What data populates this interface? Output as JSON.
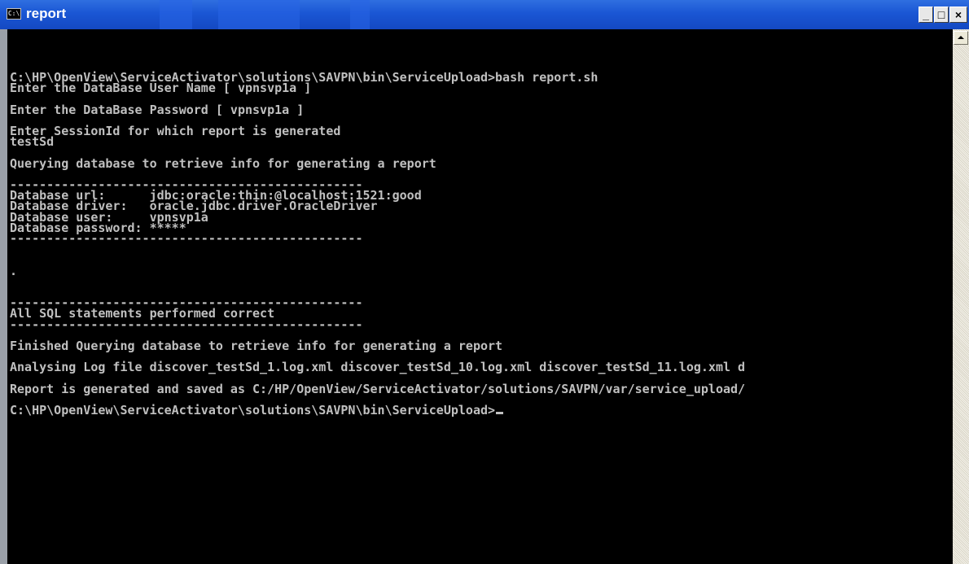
{
  "window": {
    "title": "report",
    "icon": "console-icon",
    "icon_glyph": "C:\\",
    "buttons": {
      "minimize": "_",
      "maximize": "□",
      "close": "×"
    }
  },
  "console": {
    "lines": [
      "",
      "C:\\HP\\OpenView\\ServiceActivator\\solutions\\SAVPN\\bin\\ServiceUpload>bash report.sh",
      "Enter the DataBase User Name [ vpnsvp1a ]",
      "",
      "Enter the DataBase Password [ vpnsvp1a ]",
      "",
      "Enter SessionId for which report is generated",
      "testSd",
      "",
      "Querying database to retrieve info for generating a report",
      "",
      "------------------------------------------------",
      "Database url:      jdbc:oracle:thin:@localhost:1521:good",
      "Database driver:   oracle.jdbc.driver.OracleDriver",
      "Database user:     vpnsvp1a",
      "Database password: *****",
      "------------------------------------------------",
      "",
      "",
      ".",
      "",
      "",
      "------------------------------------------------",
      "All SQL statements performed correct",
      "------------------------------------------------",
      "",
      "Finished Querying database to retrieve info for generating a report",
      "",
      "Analysing Log file discover_testSd_1.log.xml discover_testSd_10.log.xml discover_testSd_11.log.xml d",
      "",
      "Report is generated and saved as C:/HP/OpenView/ServiceActivator/solutions/SAVPN/var/service_upload/",
      "",
      "C:\\HP\\OpenView\\ServiceActivator\\solutions\\SAVPN\\bin\\ServiceUpload>"
    ]
  },
  "scrollbar": {
    "up_icon": "scroll-up-arrow-icon"
  },
  "colors": {
    "titlebar": "#1a56d4",
    "console_bg": "#000000",
    "console_text": "#c0c0c0",
    "scrollbar_track": "#ebe9e0"
  }
}
